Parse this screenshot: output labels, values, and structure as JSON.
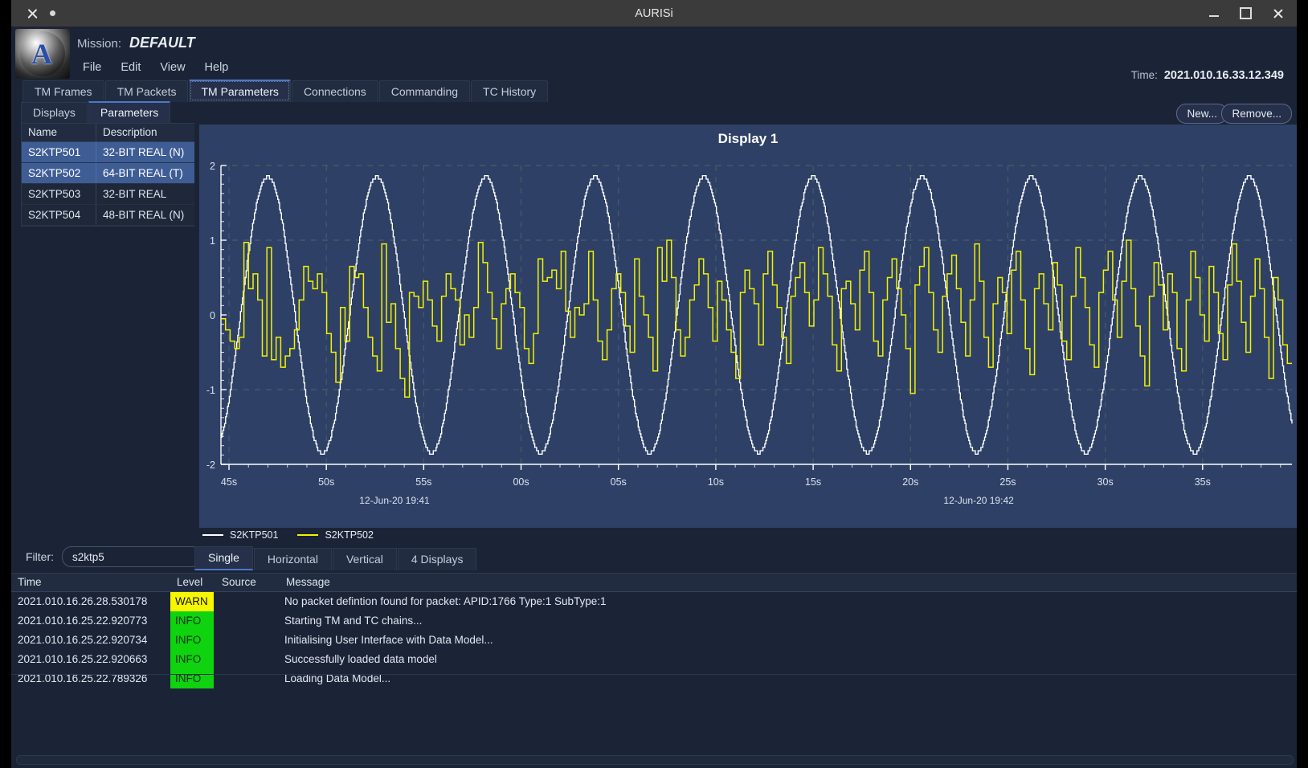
{
  "window": {
    "title": "AURISi",
    "close_icon": "close-icon",
    "dot_icon": "dot-icon",
    "minimize_icon": "minimize-icon",
    "maximize_icon": "maximize-icon",
    "close_right_icon": "close-icon"
  },
  "header": {
    "mission_label": "Mission:",
    "mission_value": "DEFAULT",
    "menu": [
      "File",
      "Edit",
      "View",
      "Help"
    ],
    "time_label": "Time:",
    "time_value": "2021.010.16.33.12.349",
    "logo_letter": "A"
  },
  "main_tabs": [
    {
      "label": "TM Frames",
      "selected": false
    },
    {
      "label": "TM Packets",
      "selected": false
    },
    {
      "label": "TM Parameters",
      "selected": true
    },
    {
      "label": "Connections",
      "selected": false
    },
    {
      "label": "Commanding",
      "selected": false
    },
    {
      "label": "TC History",
      "selected": false
    }
  ],
  "sub_tabs": [
    {
      "label": "Displays",
      "selected": false
    },
    {
      "label": "Parameters",
      "selected": true
    }
  ],
  "parameters_table": {
    "columns": [
      "Name",
      "Description"
    ],
    "rows": [
      {
        "name": "S2KTP501",
        "description": "32-BIT REAL (N)",
        "selected": true
      },
      {
        "name": "S2KTP502",
        "description": "64-BIT REAL (T)",
        "selected": true
      },
      {
        "name": "S2KTP503",
        "description": "32-BIT REAL",
        "selected": false
      },
      {
        "name": "S2KTP504",
        "description": "48-BIT REAL (N)",
        "selected": false
      }
    ]
  },
  "filter": {
    "label": "Filter:",
    "value": "s2ktp5",
    "placeholder": "s2ktp5"
  },
  "plot_toolbar": {
    "new_label": "New...",
    "remove_label": "Remove..."
  },
  "plot_mode_tabs": [
    {
      "label": "Single",
      "selected": true
    },
    {
      "label": "Horizontal",
      "selected": false
    },
    {
      "label": "Vertical",
      "selected": false
    },
    {
      "label": "4 Displays",
      "selected": false
    }
  ],
  "chart_data": {
    "type": "line",
    "title": "Display 1",
    "xlabel": "",
    "ylabel": "",
    "ylim": [
      -2,
      2
    ],
    "yticks": [
      2,
      1,
      0,
      -1,
      -2
    ],
    "ytick_labels": [
      "2",
      "1",
      "0",
      "-1",
      "-2"
    ],
    "xtick_labels": [
      "45s",
      "50s",
      "55s",
      "00s",
      "05s",
      "10s",
      "15s",
      "20s",
      "25s",
      "30s",
      "35s"
    ],
    "x_range_labels": [
      "12-Jun-20 19:41",
      "12-Jun-20 19:42"
    ],
    "grid": true,
    "legend_position": "bottom-left",
    "series": [
      {
        "name": "S2KTP501",
        "color": "#ffffff",
        "kind": "sine-stepped",
        "amplitude": 1.85,
        "period_seconds": 5.6,
        "phase_seconds": 1.4,
        "description": "Stepped/quantised sine wave oscillating between about -1.85 and +1.85"
      },
      {
        "name": "S2KTP502",
        "color": "#f2f200",
        "kind": "noise-stepped",
        "amplitude": 1.1,
        "description": "Stepped pseudo-random noise signal mostly within -1.2 to +1.1 with slow envelope",
        "values": [
          -0.05,
          -0.2,
          -0.35,
          -0.45,
          -0.3,
          0.97,
          0.35,
          0.55,
          0.2,
          -0.55,
          0.9,
          -0.6,
          -0.3,
          -0.7,
          -0.55,
          -0.45,
          -0.2,
          0.2,
          0.65,
          0.45,
          0.35,
          0.55,
          0.3,
          -0.25,
          -0.5,
          -0.9,
          0.1,
          -0.35,
          0.65,
          0.5,
          0.55,
          0.1,
          -0.3,
          -0.55,
          -0.75,
          0.95,
          -0.1,
          0.15,
          -0.45,
          -0.85,
          -1.1,
          0.3,
          0.25,
          0.1,
          0.45,
          0.2,
          -0.15,
          -0.35,
          0.25,
          0.55,
          0.35,
          0.2,
          -0.4,
          0.0,
          -0.3,
          0.1,
          0.97,
          0.7,
          0.3,
          -0.05,
          -0.45,
          0.15,
          0.35,
          0.55,
          0.3,
          0.1,
          -0.45,
          -0.65,
          -0.25,
          0.75,
          0.45,
          0.5,
          0.6,
          0.35,
          0.85,
          0.05,
          -0.3,
          0.1,
          0.0,
          0.15,
          0.85,
          0.2,
          -0.35,
          -0.6,
          -0.2,
          0.35,
          0.55,
          0.3,
          -0.15,
          -0.5,
          0.75,
          0.25,
          0.0,
          -0.3,
          -0.75,
          0.9,
          0.45,
          1.0,
          0.5,
          -0.2,
          -0.55,
          -0.3,
          0.2,
          0.4,
          0.75,
          0.55,
          0.1,
          -0.35,
          0.45,
          0.2,
          -0.2,
          -0.5,
          -0.85,
          0.3,
          0.6,
          0.35,
          0.15,
          -0.4,
          0.55,
          0.85,
          0.4,
          0.1,
          -0.3,
          -0.65,
          0.25,
          0.5,
          0.7,
          0.3,
          -0.15,
          0.2,
          0.9,
          0.55,
          0.25,
          -0.4,
          -0.75,
          0.35,
          0.45,
          0.15,
          -0.2,
          0.6,
          0.85,
          0.3,
          -0.35,
          -0.55,
          0.2,
          0.5,
          0.75,
          0.35,
          0.0,
          -0.45,
          -1.05,
          0.4,
          0.65,
          0.9,
          0.3,
          -0.2,
          -0.5,
          0.25,
          0.55,
          0.8,
          0.35,
          -0.1,
          -0.55,
          0.2,
          0.95,
          0.45,
          -0.3,
          -0.7,
          0.15,
          0.5,
          0.3,
          -0.25,
          0.6,
          0.85,
          0.2,
          -0.45,
          -0.8,
          0.35,
          0.55,
          0.15,
          -0.2,
          0.7,
          0.4,
          -0.35,
          -0.6,
          0.25,
          0.9,
          0.5,
          0.1,
          -0.4,
          -0.7,
          0.3,
          0.6,
          0.85,
          0.2,
          -0.3,
          0.45,
          1.0,
          0.35,
          -0.15,
          -0.55,
          -0.95,
          0.25,
          0.7,
          0.4,
          -0.2,
          0.55,
          0.3,
          -0.45,
          -0.75,
          0.2,
          0.85,
          0.5,
          0.0,
          -0.35,
          0.65,
          0.3,
          -0.25,
          -0.6,
          0.4,
          0.95,
          0.45,
          -0.1,
          -0.5,
          0.25,
          0.75,
          0.35,
          -0.3,
          -0.85,
          0.5,
          0.2,
          -0.4,
          -0.65
        ]
      }
    ]
  },
  "legend": [
    {
      "label": "S2KTP501",
      "color": "#ffffff"
    },
    {
      "label": "S2KTP502",
      "color": "#f2f200"
    }
  ],
  "log": {
    "columns": [
      "Time",
      "Level",
      "Source",
      "Message"
    ],
    "rows": [
      {
        "time": "2021.010.16.26.28.530178",
        "level": "WARN",
        "source": "",
        "message": "No packet defintion found for packet: APID:1766 Type:1 SubType:1"
      },
      {
        "time": "2021.010.16.25.22.920773",
        "level": "INFO",
        "source": "",
        "message": "Starting TM and TC chains..."
      },
      {
        "time": "2021.010.16.25.22.920734",
        "level": "INFO",
        "source": "",
        "message": "Initialising User Interface with Data Model..."
      },
      {
        "time": "2021.010.16.25.22.920663",
        "level": "INFO",
        "source": "",
        "message": "Successfully loaded data model"
      },
      {
        "time": "2021.010.16.25.22.789326",
        "level": "INFO",
        "source": "",
        "message": "Loading Data Model..."
      }
    ]
  },
  "colors": {
    "accent": "#4a79c8",
    "plot_bg": "#2e4066",
    "panel_bg": "#1b2436",
    "warn": "#f6f600",
    "info": "#0ed30e",
    "series1": "#ffffff",
    "series2": "#f2f200"
  }
}
